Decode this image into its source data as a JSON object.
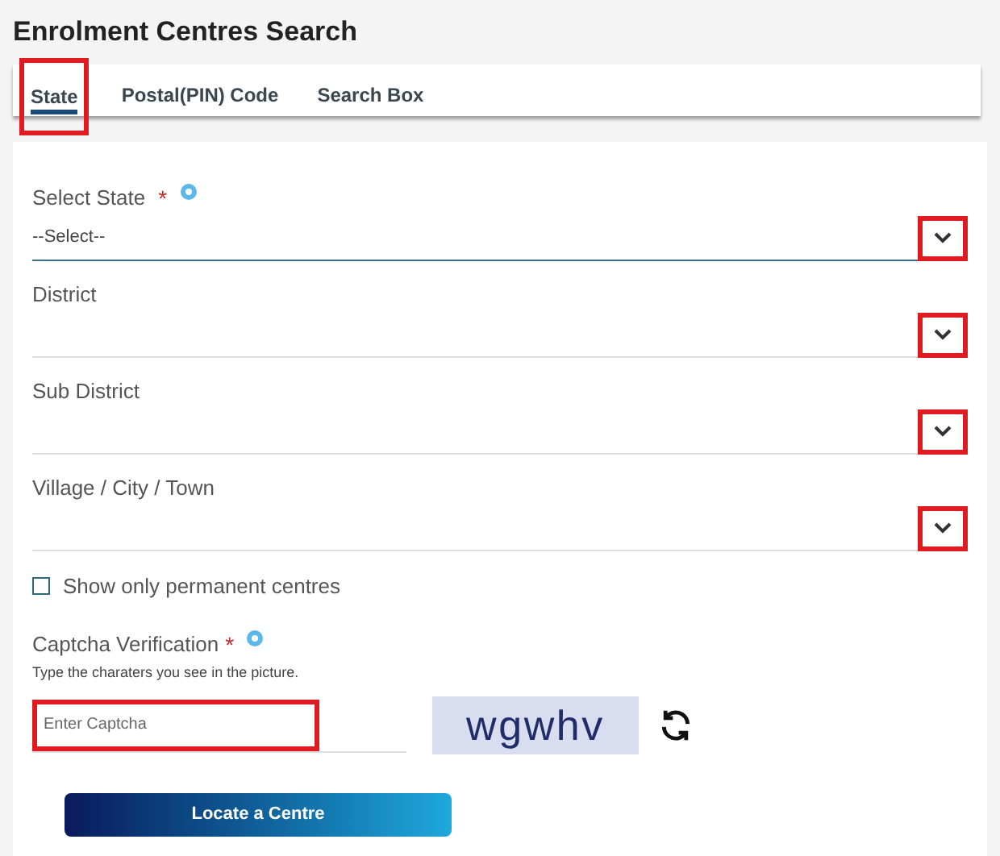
{
  "title": "Enrolment Centres Search",
  "tabs": [
    {
      "label": "State",
      "selected": true,
      "highlighted": true
    },
    {
      "label": "Postal(PIN) Code",
      "selected": false,
      "highlighted": false
    },
    {
      "label": "Search Box",
      "selected": false,
      "highlighted": false
    }
  ],
  "fields": [
    {
      "label": "Select State",
      "required_mark": "*",
      "info": true,
      "value": "--Select--",
      "focused": true,
      "highlighted": true
    },
    {
      "label": "District",
      "info": false,
      "focused": false,
      "highlighted": true
    },
    {
      "label": "Sub District",
      "info": false,
      "focused": false,
      "highlighted": true
    },
    {
      "label": "Village / City / Town",
      "info": false,
      "focused": false,
      "highlighted": true
    }
  ],
  "permanent_checkbox": {
    "label": "Show only permanent centres",
    "checked": false
  },
  "captcha": {
    "label": "Captcha Verification",
    "required_mark": "*",
    "hint": "Type the charaters you see in the picture.",
    "placeholder": "Enter Captcha",
    "highlighted": true,
    "image_text": "wgwhv"
  },
  "submit_button": "Locate a Centre"
}
